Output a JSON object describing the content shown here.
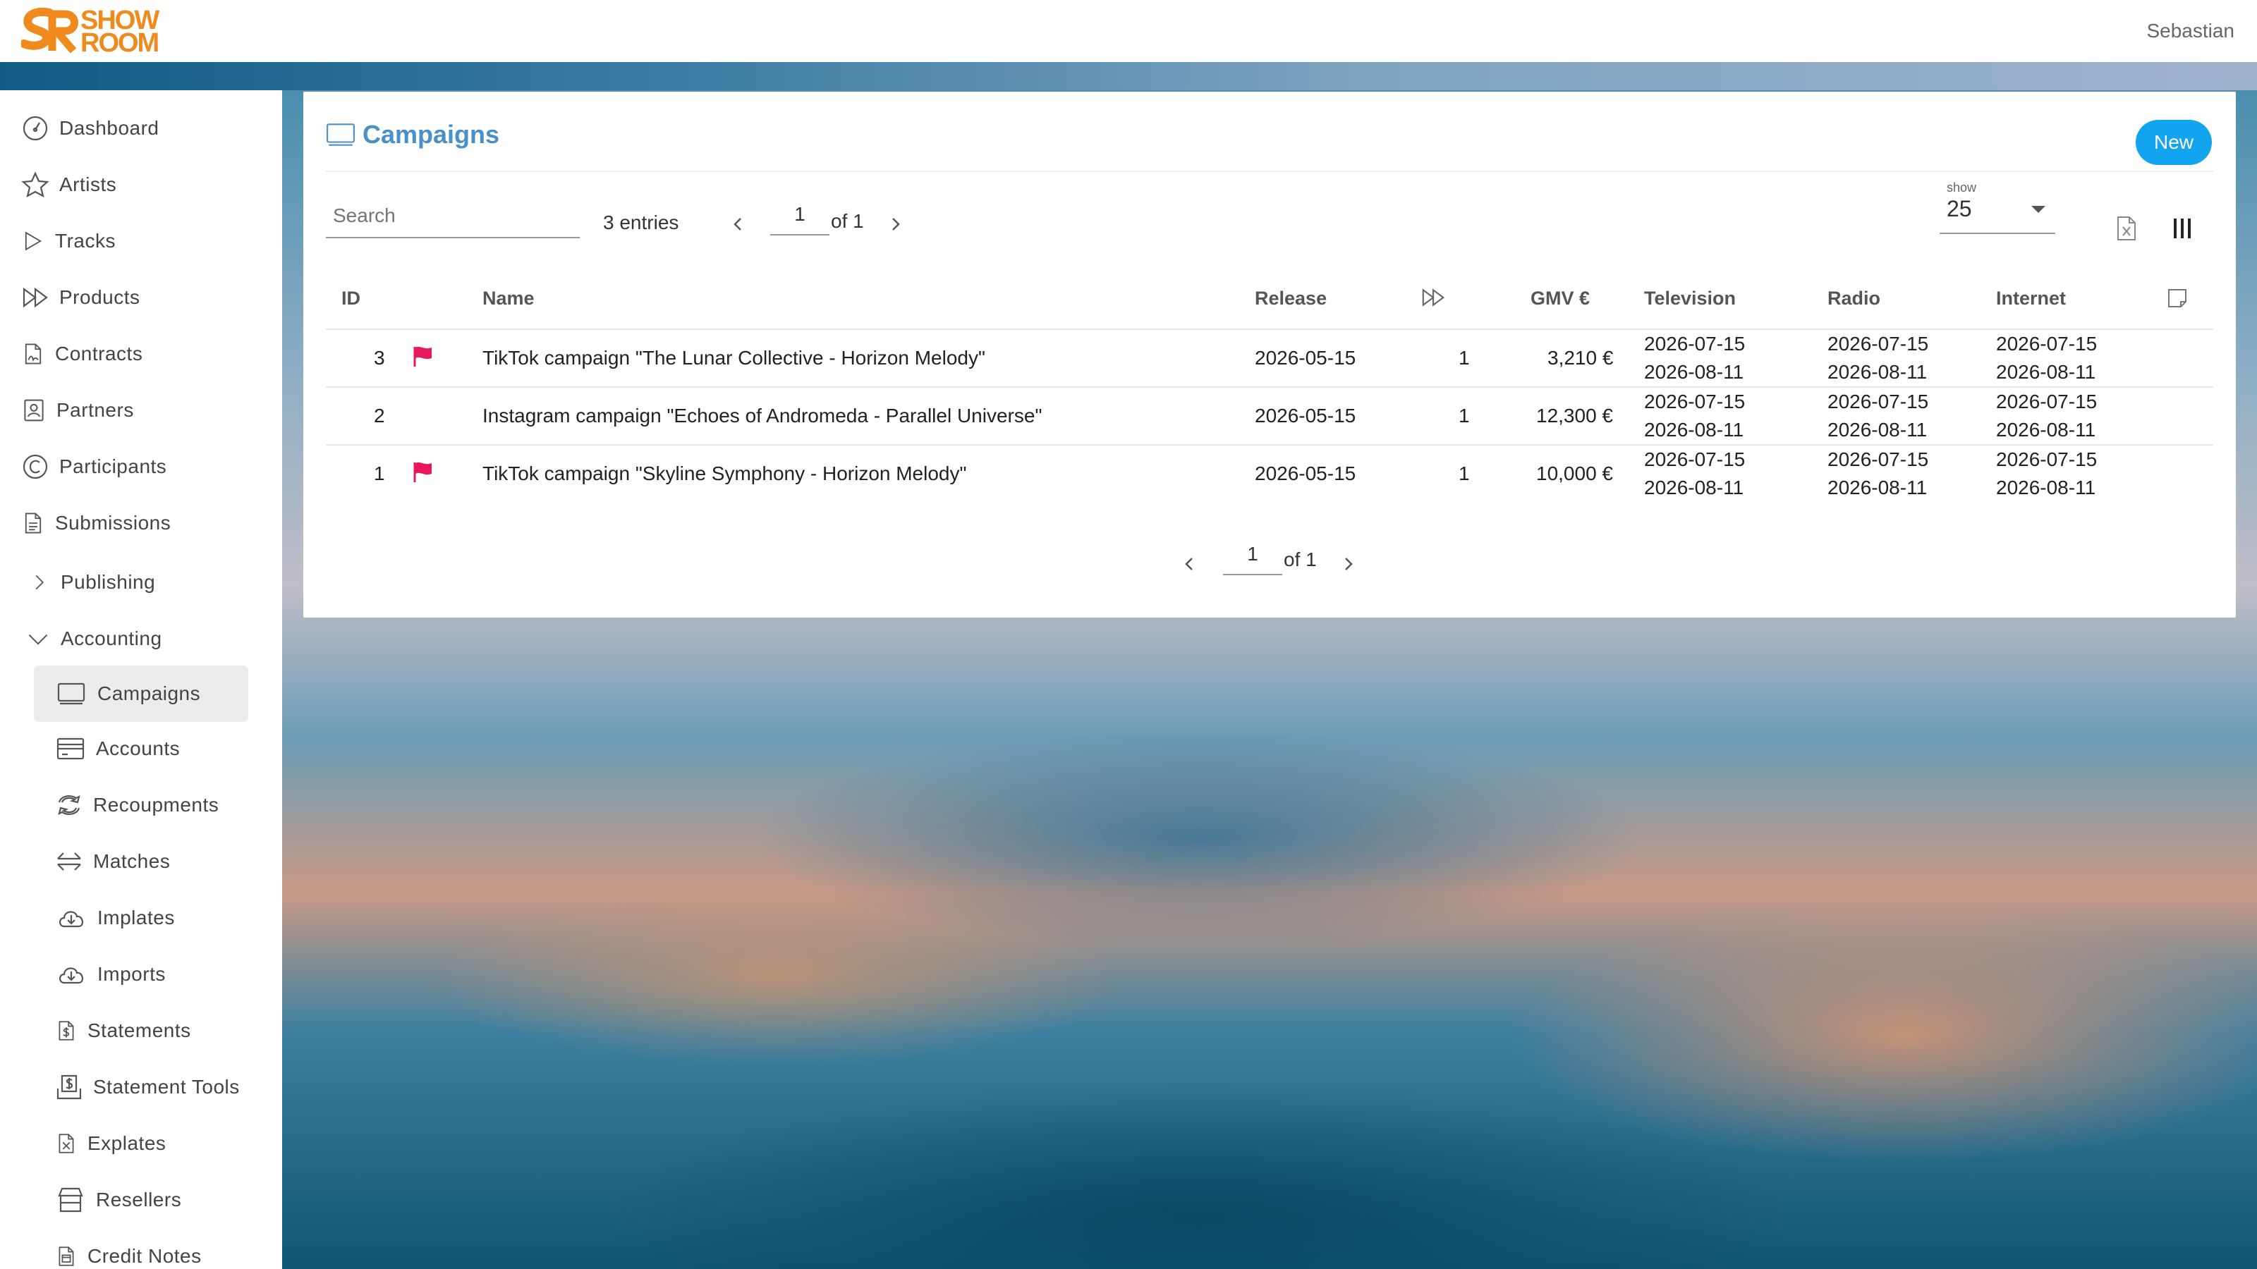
{
  "app": {
    "logo_top": "SHOW",
    "logo_bottom": "ROOM",
    "user": "Sebastian"
  },
  "sidebar": {
    "items": [
      {
        "label": "Dashboard",
        "icon": "dashboard-icon"
      },
      {
        "label": "Artists",
        "icon": "star-icon"
      },
      {
        "label": "Tracks",
        "icon": "play-icon"
      },
      {
        "label": "Products",
        "icon": "fast-forward-icon"
      },
      {
        "label": "Contracts",
        "icon": "contract-icon"
      },
      {
        "label": "Partners",
        "icon": "partner-icon"
      },
      {
        "label": "Participants",
        "icon": "copyright-icon"
      },
      {
        "label": "Submissions",
        "icon": "document-icon"
      },
      {
        "label": "Publishing",
        "icon": "chevron-right-icon"
      },
      {
        "label": "Accounting",
        "icon": "chevron-down-icon"
      },
      {
        "label": "Campaigns",
        "icon": "monitor-icon"
      },
      {
        "label": "Accounts",
        "icon": "card-icon"
      },
      {
        "label": "Recoupments",
        "icon": "refresh-icon"
      },
      {
        "label": "Matches",
        "icon": "arrows-horizontal-icon"
      },
      {
        "label": "Implates",
        "icon": "cloud-download-icon"
      },
      {
        "label": "Imports",
        "icon": "cloud-download-icon"
      },
      {
        "label": "Statements",
        "icon": "dollar-document-icon"
      },
      {
        "label": "Statement Tools",
        "icon": "dollar-tray-icon"
      },
      {
        "label": "Explates",
        "icon": "excel-document-icon"
      },
      {
        "label": "Resellers",
        "icon": "store-icon"
      },
      {
        "label": "Credit Notes",
        "icon": "credit-note-icon"
      }
    ]
  },
  "main": {
    "title": "Campaigns",
    "new_label": "New",
    "search_placeholder": "Search",
    "entries": "3 entries",
    "page": "1",
    "page_of": "of 1",
    "show_label": "show",
    "show_value": "25",
    "columns": {
      "id": "ID",
      "name": "Name",
      "release": "Release",
      "gmv": "GMV €",
      "television": "Television",
      "radio": "Radio",
      "internet": "Internet"
    },
    "rows": [
      {
        "id": "3",
        "flag": true,
        "name": "TikTok campaign \"The Lunar Collective - Horizon Melody\"",
        "release": "2026-05-15",
        "count": "1",
        "gmv": "3,210 €",
        "tv_start": "2026-07-15",
        "tv_end": "2026-08-11",
        "radio_start": "2026-07-15",
        "radio_end": "2026-08-11",
        "net_start": "2026-07-15",
        "net_end": "2026-08-11"
      },
      {
        "id": "2",
        "flag": false,
        "name": "Instagram campaign \"Echoes of Andromeda - Parallel Universe\"",
        "release": "2026-05-15",
        "count": "1",
        "gmv": "12,300 €",
        "tv_start": "2026-07-15",
        "tv_end": "2026-08-11",
        "radio_start": "2026-07-15",
        "radio_end": "2026-08-11",
        "net_start": "2026-07-15",
        "net_end": "2026-08-11"
      },
      {
        "id": "1",
        "flag": true,
        "name": "TikTok campaign \"Skyline Symphony - Horizon Melody\"",
        "release": "2026-05-15",
        "count": "1",
        "gmv": "10,000 €",
        "tv_start": "2026-07-15",
        "tv_end": "2026-08-11",
        "radio_start": "2026-07-15",
        "radio_end": "2026-08-11",
        "net_start": "2026-07-15",
        "net_end": "2026-08-11"
      }
    ],
    "colors": {
      "accent": "#4a90c8",
      "button": "#13a4f0",
      "flag": "#e8175d",
      "logo": "#f08a1c"
    }
  }
}
